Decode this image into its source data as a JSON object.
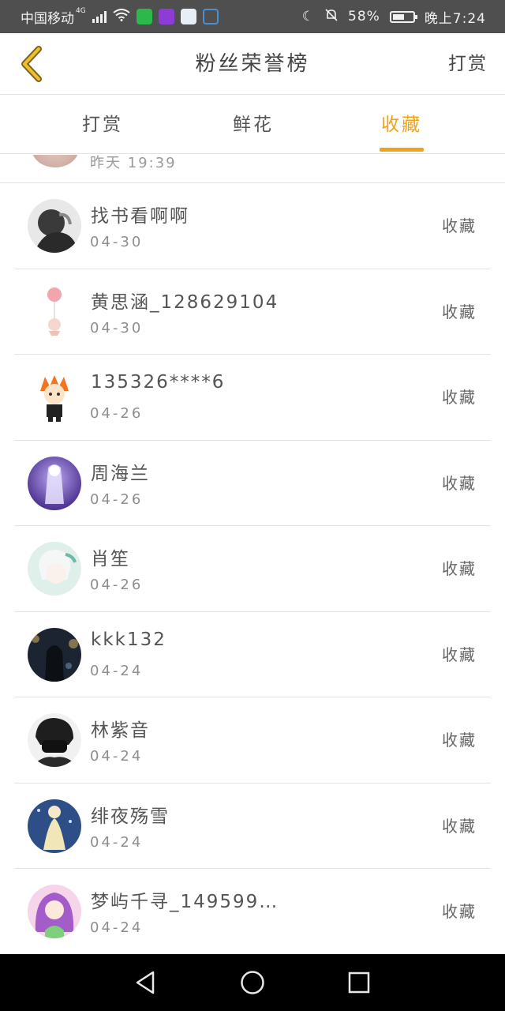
{
  "status_bar": {
    "carrier": "中国移动",
    "network": "4G",
    "battery": "58%",
    "battery_level": 0.58,
    "time": "晚上7:24"
  },
  "header": {
    "title": "粉丝荣誉榜",
    "action": "打赏",
    "back_icon": "chevron-left-icon",
    "accent_color": "#f0a21b"
  },
  "tabs": [
    {
      "label": "打赏",
      "active": false
    },
    {
      "label": "鲜花",
      "active": false
    },
    {
      "label": "收藏",
      "active": true
    }
  ],
  "partial_row": {
    "time": "昨天 19:39"
  },
  "fans": [
    {
      "name": "找书看啊啊",
      "date": "04-30",
      "action": "收藏"
    },
    {
      "name": "黄思涵_128629104",
      "date": "04-30",
      "action": "收藏"
    },
    {
      "name": "135326****6",
      "date": "04-26",
      "action": "收藏"
    },
    {
      "name": "周海兰",
      "date": "04-26",
      "action": "收藏"
    },
    {
      "name": "肖笙",
      "date": "04-26",
      "action": "收藏"
    },
    {
      "name": "kkk132",
      "date": "04-24",
      "action": "收藏"
    },
    {
      "name": "林紫音",
      "date": "04-24",
      "action": "收藏"
    },
    {
      "name": "绯夜殇雪",
      "date": "04-24",
      "action": "收藏"
    },
    {
      "name": "梦屿千寻_149599…",
      "date": "04-24",
      "action": "收藏"
    }
  ],
  "nav": {
    "back": "back-triangle-icon",
    "home": "home-circle-icon",
    "recent": "recents-square-icon"
  }
}
